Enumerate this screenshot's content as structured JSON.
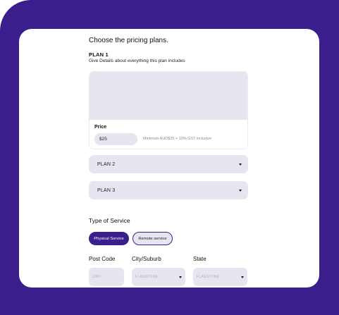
{
  "form": {
    "heading": "Choose the pricing plans.",
    "plan1": {
      "title": "PLAN 1",
      "description_label": "Give Details about everything this plan includes",
      "description_value": "",
      "price_label": "Price",
      "price_value": "$25",
      "price_note": "Minimum AUD$25 + 10% GST inclusive"
    },
    "plans": [
      {
        "label": "PLAN 2"
      },
      {
        "label": "PLAN 3"
      }
    ],
    "service": {
      "label": "Type of Service",
      "options": [
        "Physical Service",
        "Remote service"
      ],
      "selected": "Physical Service"
    },
    "location": {
      "postcode_label": "Post Code",
      "postcode_placeholder": "1080",
      "city_label": "City/Suburb",
      "city_placeholder": "FLAGSTONE",
      "state_label": "State",
      "state_placeholder": "FLAGSTONE"
    }
  },
  "colors": {
    "brand": "#3a1e8c",
    "field_bg": "#e7e5f0",
    "card_bg": "#ffffff"
  }
}
